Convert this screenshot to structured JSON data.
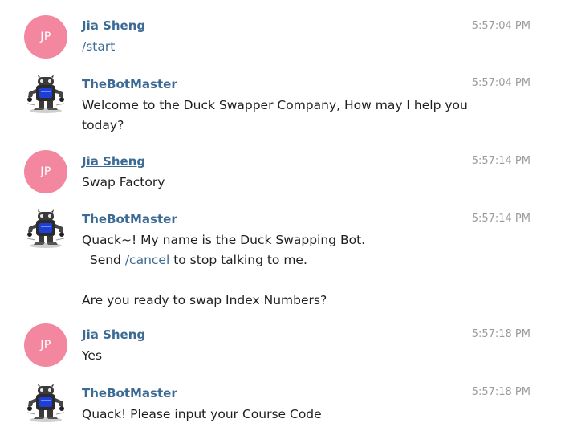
{
  "messages": [
    {
      "sender": "Jia Sheng",
      "time": "5:57:04 PM",
      "avatar_initials": "JP",
      "lines": [
        {
          "pre": "",
          "link": "/start",
          "post": ""
        }
      ]
    },
    {
      "sender": "TheBotMaster",
      "time": "5:57:04 PM",
      "avatar_icon": "robot-icon",
      "lines": [
        {
          "pre": "Welcome to the Duck Swapper Company, How may I help you",
          "link": "",
          "post": ""
        },
        {
          "pre": "today?",
          "link": "",
          "post": ""
        }
      ]
    },
    {
      "sender": "Jia Sheng",
      "time": "5:57:14 PM",
      "avatar_initials": "JP",
      "lines": [
        {
          "pre": "Swap Factory",
          "link": "",
          "post": ""
        }
      ]
    },
    {
      "sender": "TheBotMaster",
      "time": "5:57:14 PM",
      "avatar_icon": "robot-icon",
      "lines": [
        {
          "pre": "Quack~! My name is the Duck Swapping Bot.",
          "link": "",
          "post": ""
        },
        {
          "pre": "  Send ",
          "link": "/cancel",
          "post": " to stop talking to me."
        },
        {
          "pre": "",
          "link": "",
          "post": ""
        },
        {
          "pre": "Are you ready to swap Index Numbers?",
          "link": "",
          "post": ""
        }
      ]
    },
    {
      "sender": "Jia Sheng",
      "time": "5:57:18 PM",
      "avatar_initials": "JP",
      "lines": [
        {
          "pre": "Yes",
          "link": "",
          "post": ""
        }
      ]
    },
    {
      "sender": "TheBotMaster",
      "time": "5:57:18 PM",
      "avatar_icon": "robot-icon",
      "lines": [
        {
          "pre": "Quack! Please input your Course Code",
          "link": "",
          "post": ""
        }
      ]
    }
  ]
}
